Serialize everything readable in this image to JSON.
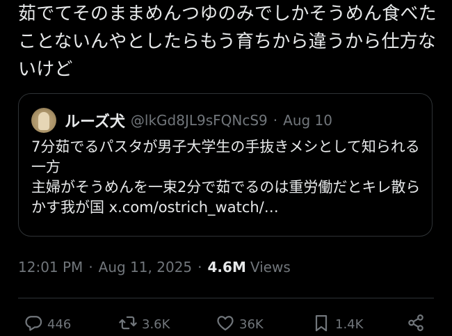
{
  "tweet": {
    "text": "茹でてそのままめんつゆのみでしかそうめん食べたことないんやとしたらもう育ちから違うから仕方ないけど"
  },
  "quote": {
    "author_name": "ルーズ犬",
    "author_handle": "@lkGd8JL9sFQNcS9",
    "separator": "·",
    "date": "Aug 10",
    "text": "7分茹でるパスタが男子大学生の手抜きメシとして知られる一方\n主婦がそうめんを一束2分で茹でるのは重労働だとキレ散らかす我が国 x.com/ostrich_watch/…"
  },
  "meta": {
    "time": "12:01 PM",
    "separator": "·",
    "date": "Aug 11, 2025",
    "views_count": "4.6M",
    "views_label": "Views"
  },
  "actions": {
    "replies": "446",
    "reposts": "3.6K",
    "likes": "36K",
    "bookmarks": "1.4K"
  },
  "colors": {
    "background": "#000000",
    "text_primary": "#e7e9ea",
    "text_secondary": "#71767b",
    "border": "#2f3336"
  }
}
